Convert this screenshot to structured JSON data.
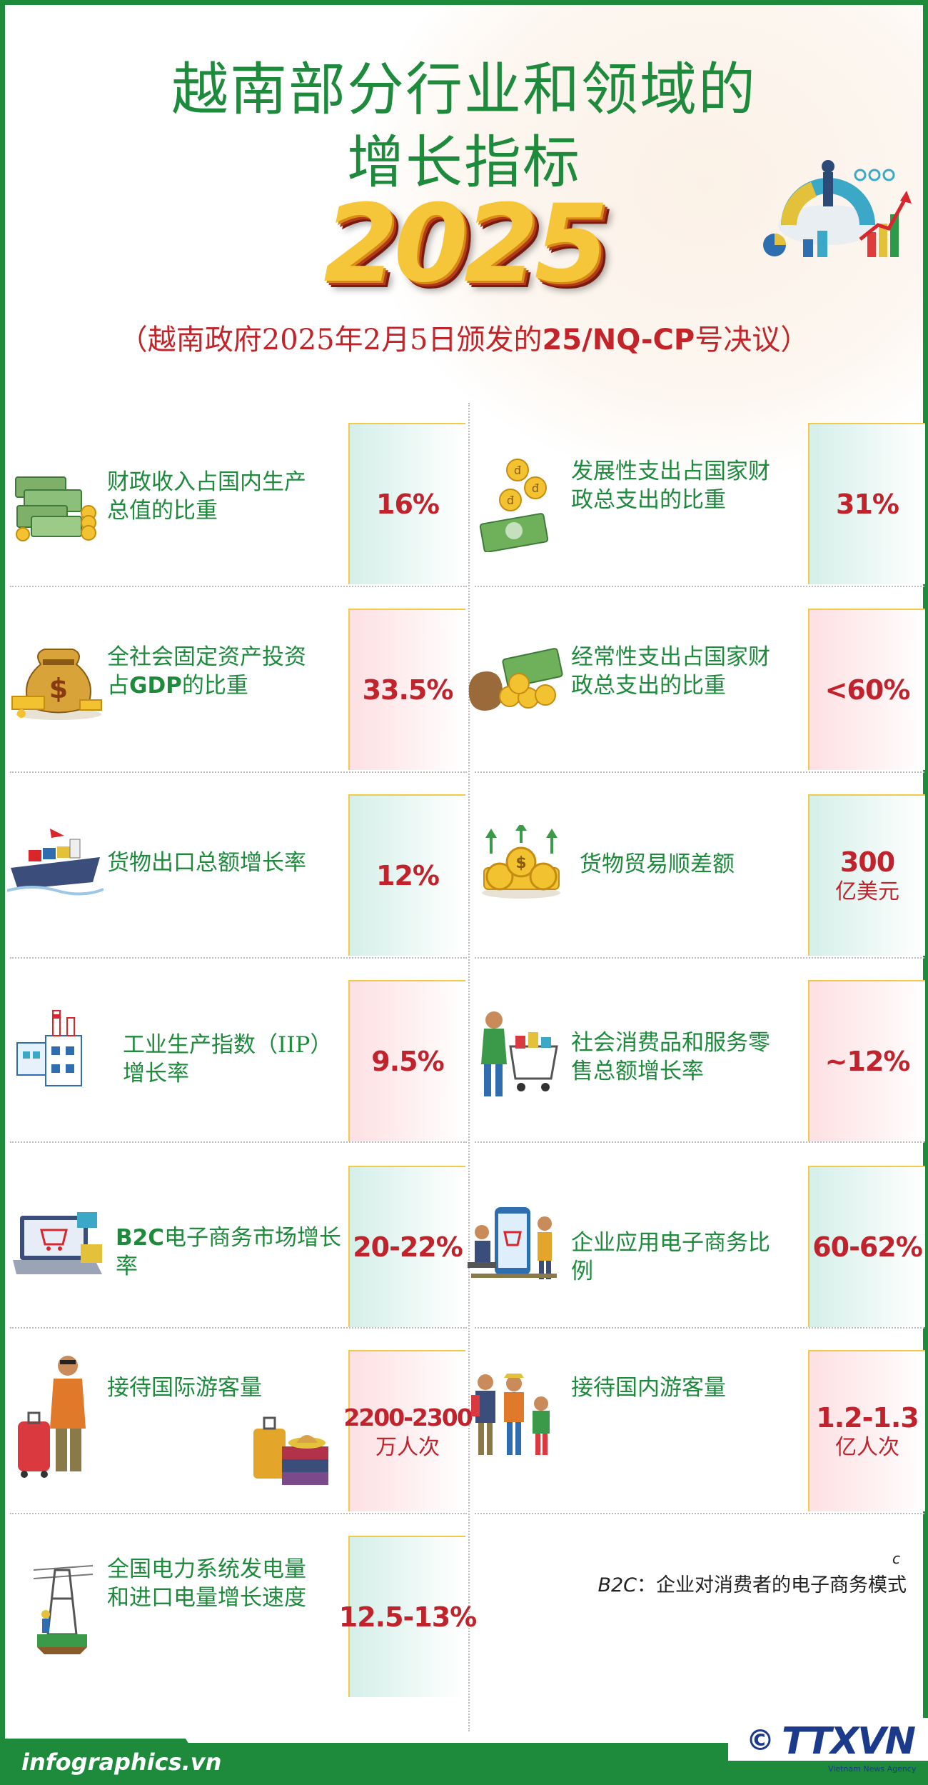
{
  "title_line1": "越南部分行业和领域的",
  "title_line2": "增长指标",
  "year": "2025",
  "subtitle_prefix": "（越南政府2025年2月5日颁发的",
  "subtitle_bold": "25/NQ-CP",
  "subtitle_suffix": "号决议）",
  "left": [
    {
      "label": "财政收入占国内生产\n总值的比重",
      "value": "16%",
      "unit": "",
      "icon": "money-stack-icon"
    },
    {
      "label_pre": "全社会固定资产投资\n占",
      "label_bold": "GDP",
      "label_post": "的比重",
      "value": "33.5%",
      "unit": "",
      "icon": "money-bag-icon"
    },
    {
      "label": "货物出口总额增长率",
      "value": "12%",
      "unit": "",
      "icon": "cargo-ship-icon"
    },
    {
      "label": "工业生产指数（IIP）\n增长率",
      "value": "9.5%",
      "unit": "",
      "icon": "factory-icon"
    },
    {
      "label_bold": "B2C",
      "label_post": "电子商务市场增长\n率",
      "value": "20-22%",
      "unit": "",
      "icon": "laptop-shopping-icon"
    },
    {
      "label": "接待国际游客量",
      "value": "2200-2300",
      "unit": "万人次",
      "icon": "traveler-icon"
    },
    {
      "label": "全国电力系统发电量\n和进口电量增长速度",
      "value": "12.5-13%",
      "unit": "",
      "icon": "power-pylon-icon"
    }
  ],
  "right": [
    {
      "label": "发展性支出占国家财\n政总支出的比重",
      "value": "31%",
      "unit": "",
      "icon": "dong-coins-icon"
    },
    {
      "label": "经常性支出占国家财\n政总支出的比重",
      "value": "<60%",
      "unit": "",
      "icon": "coins-cash-icon"
    },
    {
      "label": "货物贸易顺差额",
      "value": "300",
      "unit": "亿美元",
      "icon": "dollar-coins-arrows-icon"
    },
    {
      "label": "社会消费品和服务零\n售总额增长率",
      "value": "~12%",
      "unit": "",
      "icon": "shopping-cart-icon"
    },
    {
      "label": "企业应用电子商务比\n例",
      "value": "60-62%",
      "unit": "",
      "icon": "phone-shop-icon"
    },
    {
      "label": "接待国内游客量",
      "value": "1.2-1.3",
      "unit": "亿人次",
      "icon": "family-hikers-icon"
    }
  ],
  "note_marker": "c",
  "note_term": "B2C",
  "note_text": "：企业对消费者的电子商务模式",
  "footer_site": "infographics.vn",
  "logo_copyright": "©",
  "logo_text": "TTXVN",
  "logo_subtext": "Vietnam News Agency",
  "colors": {
    "green": "#1d8a3c",
    "red": "#c0232b",
    "gold": "#f6c63a"
  }
}
